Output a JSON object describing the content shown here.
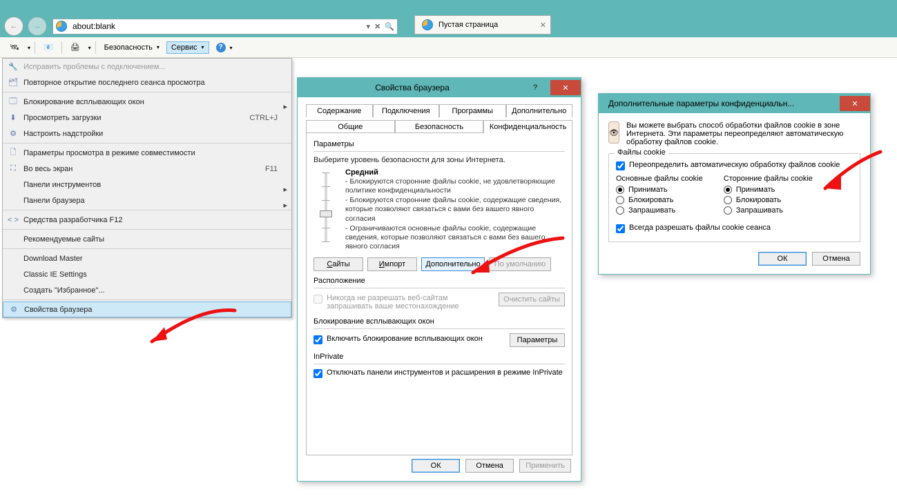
{
  "browser": {
    "url": "about:blank",
    "tab_title": "Пустая страница",
    "toolbar": {
      "security": "Безопасность",
      "tools": "Сервис"
    }
  },
  "menu": {
    "items": [
      {
        "label": "Исправить проблемы с подключением...",
        "disabled": true,
        "icon": "wrench"
      },
      {
        "label": "Повторное открытие последнего сеанса просмотра",
        "icon": "reopen"
      },
      {
        "sep": true
      },
      {
        "label": "Блокирование всплывающих окон",
        "icon": "popup",
        "sub": true
      },
      {
        "label": "Просмотреть загрузки",
        "icon": "download",
        "shortcut": "CTRL+J"
      },
      {
        "label": "Настроить надстройки",
        "icon": "addons"
      },
      {
        "sep": true
      },
      {
        "label": "Параметры просмотра в режиме совместимости",
        "icon": "compat"
      },
      {
        "label": "Во весь экран",
        "icon": "fullscreen",
        "shortcut": "F11"
      },
      {
        "label": "Панели инструментов",
        "sub": true
      },
      {
        "label": "Панели браузера",
        "sub": true
      },
      {
        "sep": true
      },
      {
        "label": "Средства разработчика F12",
        "icon": "f12"
      },
      {
        "sep": true
      },
      {
        "label": "Рекомендуемые сайты"
      },
      {
        "sep": true
      },
      {
        "label": "Download Master"
      },
      {
        "label": "Classic IE Settings"
      },
      {
        "label": "Создать \"Избранное\"..."
      },
      {
        "sep": true
      },
      {
        "label": "Свойства браузера",
        "icon": "props",
        "highlight": true
      }
    ]
  },
  "props": {
    "title": "Свойства браузера",
    "tabs_row1": [
      "Содержание",
      "Подключения",
      "Программы",
      "Дополнительно"
    ],
    "tabs_row2": [
      "Общие",
      "Безопасность",
      "Конфиденциальность"
    ],
    "active_tab": "Конфиденциальность",
    "group_params": "Параметры",
    "hint": "Выберите уровень безопасности для зоны Интернета.",
    "level": "Средний",
    "bullets": [
      "- Блокируются сторонние файлы cookie, не удовлетворяющие политике конфиденциальности",
      "- Блокируются сторонние файлы cookie, содержащие сведения, которые позволяют связаться с вами без вашего явного согласия",
      "- Ограничиваются основные файлы cookie, содержащие сведения, которые позволяют связаться с вами без вашего явного согласия"
    ],
    "btn_sites": "Сайты",
    "btn_import": "Импорт",
    "btn_adv": "Дополнительно",
    "btn_default": "По умолчанию",
    "group_loc": "Расположение",
    "loc_check": "Никогда не разрешать веб-сайтам запрашивать ваше местонахождение",
    "btn_clear": "Очистить сайты",
    "group_popup": "Блокирование всплывающих окон",
    "popup_check": "Включить блокирование всплывающих окон",
    "btn_popup": "Параметры",
    "group_inpriv": "InPrivate",
    "inpriv_check": "Отключать панели инструментов и расширения в режиме InPrivate",
    "ok": "ОК",
    "cancel": "Отмена",
    "apply": "Применить"
  },
  "adv": {
    "title": "Дополнительные параметры конфиденциальн...",
    "intro": "Вы можете выбрать способ обработки файлов cookie в зоне Интернета. Эти параметры переопределяют автоматическую обработку файлов cookie.",
    "legend": "Файлы cookie",
    "override": "Переопределить автоматическую обработку файлов cookie",
    "col1": "Основные файлы cookie",
    "col2": "Сторонние файлы cookie",
    "opt_accept": "Принимать",
    "opt_block": "Блокировать",
    "opt_ask": "Запрашивать",
    "session": "Всегда разрешать файлы cookie сеанса",
    "ok": "ОК",
    "cancel": "Отмена"
  }
}
